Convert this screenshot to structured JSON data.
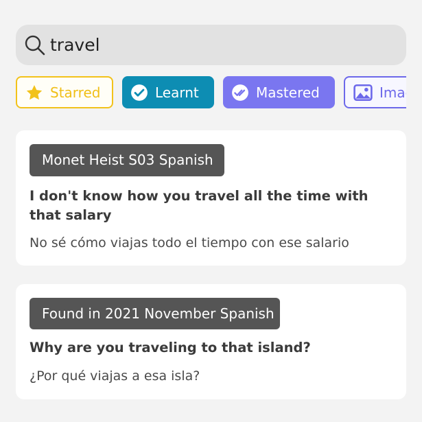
{
  "search": {
    "value": "travel",
    "icon": "search-icon"
  },
  "filters": [
    {
      "label": "Starred",
      "icon": "star-icon",
      "color": "#f2c21a"
    },
    {
      "label": "Learnt",
      "icon": "check-circle-icon",
      "color": "#0d8db3"
    },
    {
      "label": "Mastered",
      "icon": "double-check-circle-icon",
      "color": "#7a76f0"
    },
    {
      "label": "Images",
      "icon": "image-icon",
      "color": "#6c68ea"
    }
  ],
  "results": [
    {
      "source": "Monet Heist S03 Spanish",
      "sentence": "I don't know how you travel all the time with that salary",
      "translation": "No sé cómo viajas todo el tiempo con ese salario"
    },
    {
      "source": "Found in 2021 November Spanish",
      "sentence": "Why are you traveling to that island?",
      "translation": "¿Por qué viajas a esa isla?"
    }
  ]
}
